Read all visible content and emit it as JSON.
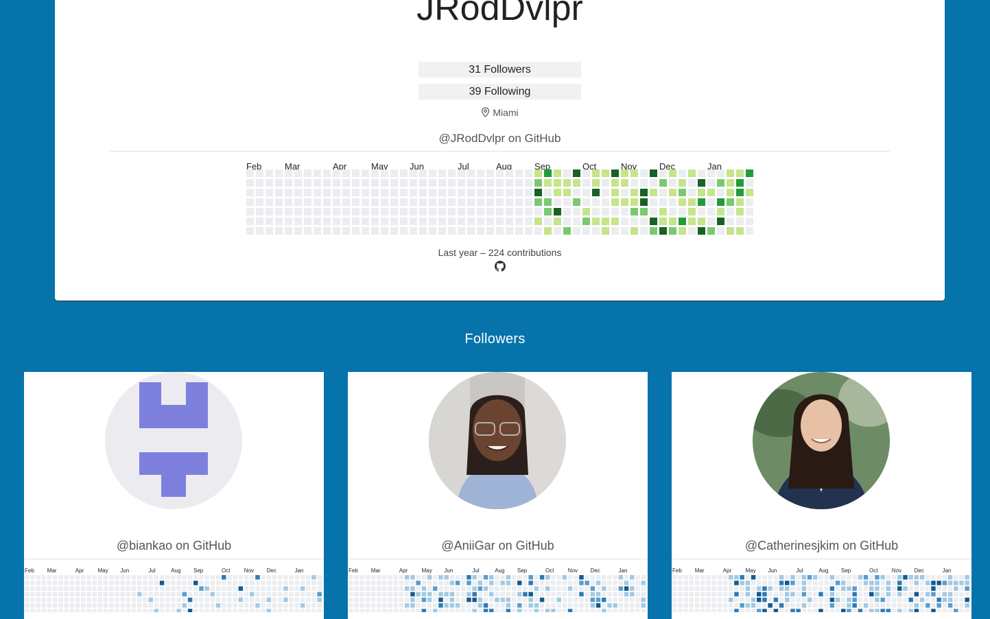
{
  "profile": {
    "username": "JRodDvlpr",
    "followers_label": "31 Followers",
    "following_label": "39 Following",
    "location": "Miami",
    "github_link": "@JRodDvlpr on GitHub",
    "summary": "Last year – 224 contributions",
    "months": [
      "Feb",
      "Mar",
      "Apr",
      "May",
      "Jun",
      "Jul",
      "Aug",
      "Sep",
      "Oct",
      "Nov",
      "Dec",
      "Jan"
    ],
    "palette": [
      "#ebedf0",
      "#c6e48b",
      "#7bc96f",
      "#239a3b",
      "#196127"
    ]
  },
  "followers_section": {
    "heading": "Followers"
  },
  "followers": [
    {
      "link": "@biankao on GitHub",
      "avatar": "identicon"
    },
    {
      "link": "@AniiGar on GitHub",
      "avatar": "photo"
    },
    {
      "link": "@Catherinesjkim on GitHub",
      "avatar": "photo"
    }
  ],
  "mini_palette": [
    "#ebedf0",
    "#a3c9e2",
    "#5a9ccc",
    "#2e7ab7",
    "#135a91"
  ],
  "icons": [
    "location-pin-icon",
    "github-icon"
  ]
}
